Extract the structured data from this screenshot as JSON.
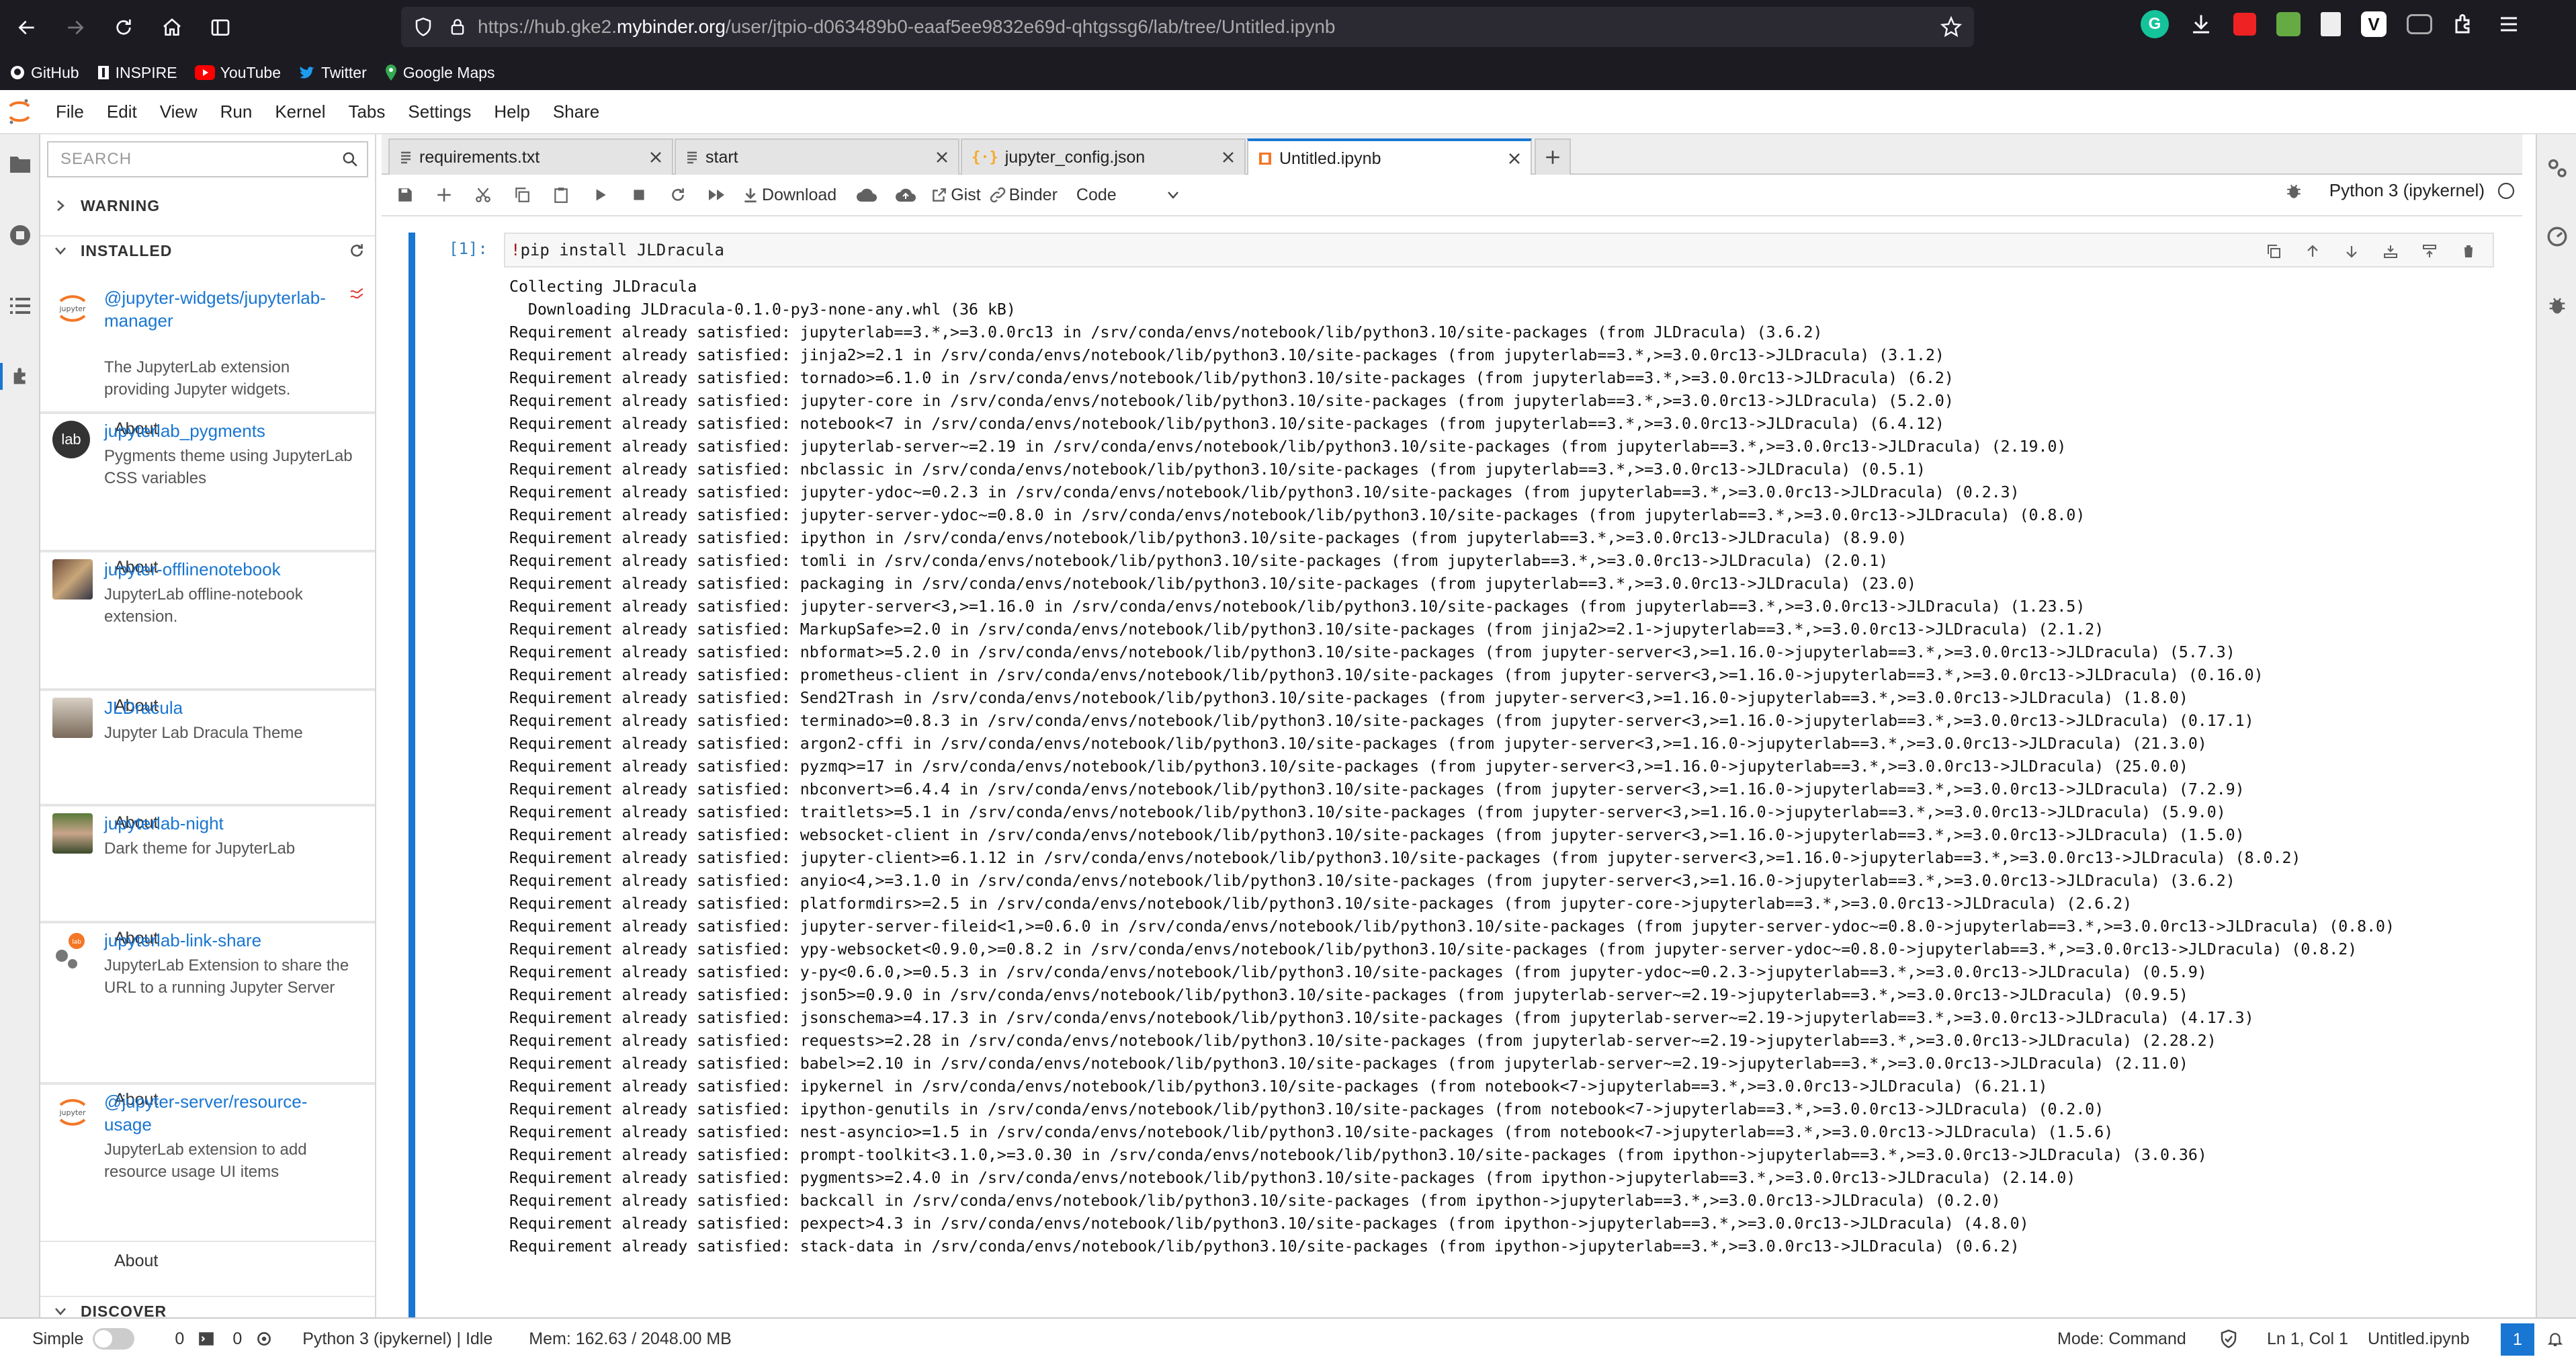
{
  "browser": {
    "url_prefix": "https://hub.gke2.",
    "url_host": "mybinder.org",
    "url_path": "/user/jtpio-d063489b0-eaaf5ee9832e69d-qhtgssg6/lab/tree/Untitled.ipynb",
    "bookmarks": [
      "GitHub",
      "INSPIRE",
      "YouTube",
      "Twitter",
      "Google Maps"
    ]
  },
  "menu": [
    "File",
    "Edit",
    "View",
    "Run",
    "Kernel",
    "Tabs",
    "Settings",
    "Help",
    "Share"
  ],
  "extensions": {
    "search_placeholder": "SEARCH",
    "warning_label": "WARNING",
    "installed_label": "INSTALLED",
    "discover_label": "DISCOVER",
    "about_label": "About",
    "items": [
      {
        "name": "@jupyter-widgets/jupyterlab-manager",
        "desc": "The JupyterLab extension providing Jupyter widgets.",
        "logo_text": "jupyter"
      },
      {
        "name": "jupyterlab_pygments",
        "desc": "Pygments theme using JupyterLab CSS variables",
        "logo_text": "lab"
      },
      {
        "name": "jupyter-offlinenotebook",
        "desc": "JupyterLab offline-notebook extension.",
        "logo_text": ""
      },
      {
        "name": "JLDracula",
        "desc": "Jupyter Lab Dracula Theme",
        "logo_text": ""
      },
      {
        "name": "jupyterlab-night",
        "desc": "Dark theme for JupyterLab",
        "logo_text": ""
      },
      {
        "name": "jupyterlab-link-share",
        "desc": "JupyterLab Extension to share the URL to a running Jupyter Server",
        "logo_text": ""
      },
      {
        "name": "@jupyter-server/resource-usage",
        "desc": "JupyterLab extension to add resource usage UI items",
        "logo_text": "jupyter"
      }
    ]
  },
  "tabs": [
    {
      "label": "requirements.txt",
      "icon": "file-text-icon"
    },
    {
      "label": "start",
      "icon": "file-text-icon"
    },
    {
      "label": "jupyter_config.json",
      "icon": "json-icon"
    },
    {
      "label": "Untitled.ipynb",
      "icon": "notebook-icon"
    }
  ],
  "toolbar": {
    "download": "Download",
    "gist": "Gist",
    "binder": "Binder",
    "cell_type": "Code",
    "kernel": "Python 3 (ipykernel)"
  },
  "cell": {
    "prompt": "[1]:",
    "source_bang": "!",
    "source_rest": "pip install JLDracula",
    "output": "Collecting JLDracula\n  Downloading JLDracula-0.1.0-py3-none-any.whl (36 kB)\nRequirement already satisfied: jupyterlab==3.*,>=3.0.0rc13 in /srv/conda/envs/notebook/lib/python3.10/site-packages (from JLDracula) (3.6.2)\nRequirement already satisfied: jinja2>=2.1 in /srv/conda/envs/notebook/lib/python3.10/site-packages (from jupyterlab==3.*,>=3.0.0rc13->JLDracula) (3.1.2)\nRequirement already satisfied: tornado>=6.1.0 in /srv/conda/envs/notebook/lib/python3.10/site-packages (from jupyterlab==3.*,>=3.0.0rc13->JLDracula) (6.2)\nRequirement already satisfied: jupyter-core in /srv/conda/envs/notebook/lib/python3.10/site-packages (from jupyterlab==3.*,>=3.0.0rc13->JLDracula) (5.2.0)\nRequirement already satisfied: notebook<7 in /srv/conda/envs/notebook/lib/python3.10/site-packages (from jupyterlab==3.*,>=3.0.0rc13->JLDracula) (6.4.12)\nRequirement already satisfied: jupyterlab-server~=2.19 in /srv/conda/envs/notebook/lib/python3.10/site-packages (from jupyterlab==3.*,>=3.0.0rc13->JLDracula) (2.19.0)\nRequirement already satisfied: nbclassic in /srv/conda/envs/notebook/lib/python3.10/site-packages (from jupyterlab==3.*,>=3.0.0rc13->JLDracula) (0.5.1)\nRequirement already satisfied: jupyter-ydoc~=0.2.3 in /srv/conda/envs/notebook/lib/python3.10/site-packages (from jupyterlab==3.*,>=3.0.0rc13->JLDracula) (0.2.3)\nRequirement already satisfied: jupyter-server-ydoc~=0.8.0 in /srv/conda/envs/notebook/lib/python3.10/site-packages (from jupyterlab==3.*,>=3.0.0rc13->JLDracula) (0.8.0)\nRequirement already satisfied: ipython in /srv/conda/envs/notebook/lib/python3.10/site-packages (from jupyterlab==3.*,>=3.0.0rc13->JLDracula) (8.9.0)\nRequirement already satisfied: tomli in /srv/conda/envs/notebook/lib/python3.10/site-packages (from jupyterlab==3.*,>=3.0.0rc13->JLDracula) (2.0.1)\nRequirement already satisfied: packaging in /srv/conda/envs/notebook/lib/python3.10/site-packages (from jupyterlab==3.*,>=3.0.0rc13->JLDracula) (23.0)\nRequirement already satisfied: jupyter-server<3,>=1.16.0 in /srv/conda/envs/notebook/lib/python3.10/site-packages (from jupyterlab==3.*,>=3.0.0rc13->JLDracula) (1.23.5)\nRequirement already satisfied: MarkupSafe>=2.0 in /srv/conda/envs/notebook/lib/python3.10/site-packages (from jinja2>=2.1->jupyterlab==3.*,>=3.0.0rc13->JLDracula) (2.1.2)\nRequirement already satisfied: nbformat>=5.2.0 in /srv/conda/envs/notebook/lib/python3.10/site-packages (from jupyter-server<3,>=1.16.0->jupyterlab==3.*,>=3.0.0rc13->JLDracula) (5.7.3)\nRequirement already satisfied: prometheus-client in /srv/conda/envs/notebook/lib/python3.10/site-packages (from jupyter-server<3,>=1.16.0->jupyterlab==3.*,>=3.0.0rc13->JLDracula) (0.16.0)\nRequirement already satisfied: Send2Trash in /srv/conda/envs/notebook/lib/python3.10/site-packages (from jupyter-server<3,>=1.16.0->jupyterlab==3.*,>=3.0.0rc13->JLDracula) (1.8.0)\nRequirement already satisfied: terminado>=0.8.3 in /srv/conda/envs/notebook/lib/python3.10/site-packages (from jupyter-server<3,>=1.16.0->jupyterlab==3.*,>=3.0.0rc13->JLDracula) (0.17.1)\nRequirement already satisfied: argon2-cffi in /srv/conda/envs/notebook/lib/python3.10/site-packages (from jupyter-server<3,>=1.16.0->jupyterlab==3.*,>=3.0.0rc13->JLDracula) (21.3.0)\nRequirement already satisfied: pyzmq>=17 in /srv/conda/envs/notebook/lib/python3.10/site-packages (from jupyter-server<3,>=1.16.0->jupyterlab==3.*,>=3.0.0rc13->JLDracula) (25.0.0)\nRequirement already satisfied: nbconvert>=6.4.4 in /srv/conda/envs/notebook/lib/python3.10/site-packages (from jupyter-server<3,>=1.16.0->jupyterlab==3.*,>=3.0.0rc13->JLDracula) (7.2.9)\nRequirement already satisfied: traitlets>=5.1 in /srv/conda/envs/notebook/lib/python3.10/site-packages (from jupyter-server<3,>=1.16.0->jupyterlab==3.*,>=3.0.0rc13->JLDracula) (5.9.0)\nRequirement already satisfied: websocket-client in /srv/conda/envs/notebook/lib/python3.10/site-packages (from jupyter-server<3,>=1.16.0->jupyterlab==3.*,>=3.0.0rc13->JLDracula) (1.5.0)\nRequirement already satisfied: jupyter-client>=6.1.12 in /srv/conda/envs/notebook/lib/python3.10/site-packages (from jupyter-server<3,>=1.16.0->jupyterlab==3.*,>=3.0.0rc13->JLDracula) (8.0.2)\nRequirement already satisfied: anyio<4,>=3.1.0 in /srv/conda/envs/notebook/lib/python3.10/site-packages (from jupyter-server<3,>=1.16.0->jupyterlab==3.*,>=3.0.0rc13->JLDracula) (3.6.2)\nRequirement already satisfied: platformdirs>=2.5 in /srv/conda/envs/notebook/lib/python3.10/site-packages (from jupyter-core->jupyterlab==3.*,>=3.0.0rc13->JLDracula) (2.6.2)\nRequirement already satisfied: jupyter-server-fileid<1,>=0.6.0 in /srv/conda/envs/notebook/lib/python3.10/site-packages (from jupyter-server-ydoc~=0.8.0->jupyterlab==3.*,>=3.0.0rc13->JLDracula) (0.8.0)\nRequirement already satisfied: ypy-websocket<0.9.0,>=0.8.2 in /srv/conda/envs/notebook/lib/python3.10/site-packages (from jupyter-server-ydoc~=0.8.0->jupyterlab==3.*,>=3.0.0rc13->JLDracula) (0.8.2)\nRequirement already satisfied: y-py<0.6.0,>=0.5.3 in /srv/conda/envs/notebook/lib/python3.10/site-packages (from jupyter-ydoc~=0.2.3->jupyterlab==3.*,>=3.0.0rc13->JLDracula) (0.5.9)\nRequirement already satisfied: json5>=0.9.0 in /srv/conda/envs/notebook/lib/python3.10/site-packages (from jupyterlab-server~=2.19->jupyterlab==3.*,>=3.0.0rc13->JLDracula) (0.9.5)\nRequirement already satisfied: jsonschema>=4.17.3 in /srv/conda/envs/notebook/lib/python3.10/site-packages (from jupyterlab-server~=2.19->jupyterlab==3.*,>=3.0.0rc13->JLDracula) (4.17.3)\nRequirement already satisfied: requests>=2.28 in /srv/conda/envs/notebook/lib/python3.10/site-packages (from jupyterlab-server~=2.19->jupyterlab==3.*,>=3.0.0rc13->JLDracula) (2.28.2)\nRequirement already satisfied: babel>=2.10 in /srv/conda/envs/notebook/lib/python3.10/site-packages (from jupyterlab-server~=2.19->jupyterlab==3.*,>=3.0.0rc13->JLDracula) (2.11.0)\nRequirement already satisfied: ipykernel in /srv/conda/envs/notebook/lib/python3.10/site-packages (from notebook<7->jupyterlab==3.*,>=3.0.0rc13->JLDracula) (6.21.1)\nRequirement already satisfied: ipython-genutils in /srv/conda/envs/notebook/lib/python3.10/site-packages (from notebook<7->jupyterlab==3.*,>=3.0.0rc13->JLDracula) (0.2.0)\nRequirement already satisfied: nest-asyncio>=1.5 in /srv/conda/envs/notebook/lib/python3.10/site-packages (from notebook<7->jupyterlab==3.*,>=3.0.0rc13->JLDracula) (1.5.6)\nRequirement already satisfied: prompt-toolkit<3.1.0,>=3.0.30 in /srv/conda/envs/notebook/lib/python3.10/site-packages (from ipython->jupyterlab==3.*,>=3.0.0rc13->JLDracula) (3.0.36)\nRequirement already satisfied: pygments>=2.4.0 in /srv/conda/envs/notebook/lib/python3.10/site-packages (from ipython->jupyterlab==3.*,>=3.0.0rc13->JLDracula) (2.14.0)\nRequirement already satisfied: backcall in /srv/conda/envs/notebook/lib/python3.10/site-packages (from ipython->jupyterlab==3.*,>=3.0.0rc13->JLDracula) (0.2.0)\nRequirement already satisfied: pexpect>4.3 in /srv/conda/envs/notebook/lib/python3.10/site-packages (from ipython->jupyterlab==3.*,>=3.0.0rc13->JLDracula) (4.8.0)\nRequirement already satisfied: stack-data in /srv/conda/envs/notebook/lib/python3.10/site-packages (from ipython->jupyterlab==3.*,>=3.0.0rc13->JLDracula) (0.6.2)"
  },
  "status": {
    "mode_label": "Simple",
    "terminals": "0",
    "kernels": "0",
    "kernel_status": "Python 3 (ipykernel) | Idle",
    "memory": "Mem: 162.63 / 2048.00 MB",
    "command_mode": "Mode: Command",
    "cursor": "Ln 1, Col 1",
    "filename": "Untitled.ipynb",
    "notifications": "1"
  },
  "colors": {
    "accent": "#1976d2",
    "browser_bg": "#1c1b22",
    "jupyter_orange": "#f37726"
  }
}
